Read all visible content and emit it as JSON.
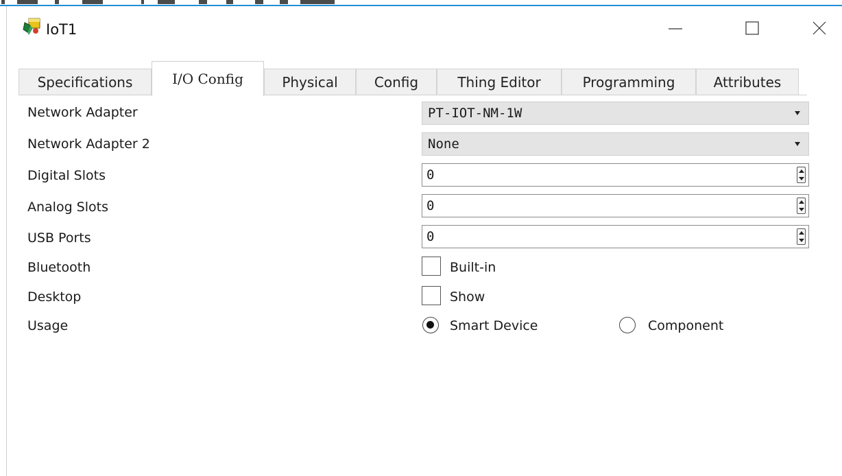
{
  "window": {
    "title": "IoT1"
  },
  "tabs": [
    {
      "label": "Specifications"
    },
    {
      "label": "I/O Config"
    },
    {
      "label": "Physical"
    },
    {
      "label": "Config"
    },
    {
      "label": "Thing Editor"
    },
    {
      "label": "Programming"
    },
    {
      "label": "Attributes"
    }
  ],
  "active_tab": "I/O Config",
  "form": {
    "network_adapter": {
      "label": "Network Adapter",
      "value": "PT-IOT-NM-1W"
    },
    "network_adapter_2": {
      "label": "Network Adapter 2",
      "value": "None"
    },
    "digital_slots": {
      "label": "Digital Slots",
      "value": "0"
    },
    "analog_slots": {
      "label": "Analog Slots",
      "value": "0"
    },
    "usb_ports": {
      "label": "USB Ports",
      "value": "0"
    },
    "bluetooth": {
      "label": "Bluetooth",
      "option": "Built-in",
      "checked": false
    },
    "desktop": {
      "label": "Desktop",
      "option": "Show",
      "checked": false
    },
    "usage": {
      "label": "Usage",
      "options": [
        "Smart Device",
        "Component"
      ],
      "selected": "Smart Device"
    }
  },
  "icons": {
    "app": "iot-device-icon",
    "minimize": "minimize-icon",
    "maximize": "maximize-icon",
    "close": "close-icon"
  },
  "colors": {
    "accent_border": "#1f8fd6",
    "select_bg": "#e4e4e4"
  }
}
